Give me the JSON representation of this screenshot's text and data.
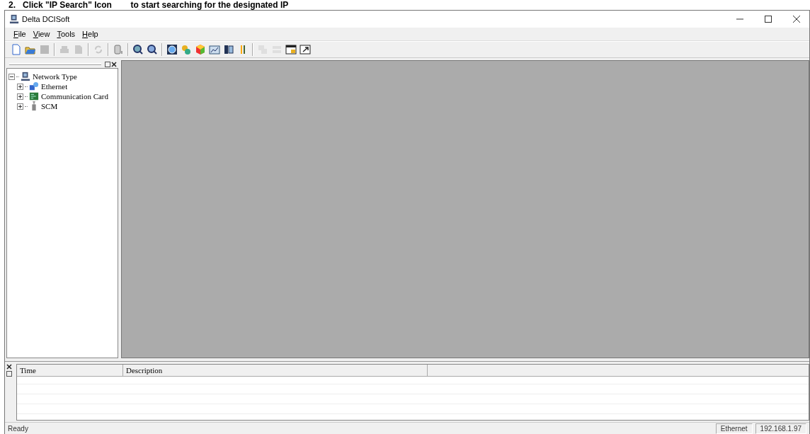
{
  "caption": "2.   Click \"IP Search\" Icon        to start searching for the designated IP",
  "window": {
    "title": "Delta DCISoft"
  },
  "menu": [
    "File",
    "View",
    "Tools",
    "Help"
  ],
  "toolbar": [
    {
      "kind": "button",
      "disabled": false
    },
    {
      "kind": "button",
      "disabled": false
    },
    {
      "kind": "button",
      "disabled": true
    },
    {
      "kind": "separator"
    },
    {
      "kind": "button",
      "disabled": true
    },
    {
      "kind": "button",
      "disabled": true
    },
    {
      "kind": "separator"
    },
    {
      "kind": "button",
      "disabled": true
    },
    {
      "kind": "separator"
    },
    {
      "kind": "button",
      "disabled": false
    },
    {
      "kind": "separator"
    },
    {
      "kind": "button",
      "disabled": false
    },
    {
      "kind": "button",
      "disabled": false
    },
    {
      "kind": "separator"
    },
    {
      "kind": "button",
      "disabled": false
    },
    {
      "kind": "button",
      "disabled": false
    },
    {
      "kind": "button",
      "disabled": false
    },
    {
      "kind": "button",
      "disabled": false
    },
    {
      "kind": "button",
      "disabled": false
    },
    {
      "kind": "button",
      "disabled": false
    },
    {
      "kind": "separator"
    },
    {
      "kind": "button",
      "disabled": true
    },
    {
      "kind": "button",
      "disabled": true
    },
    {
      "kind": "button",
      "disabled": false
    },
    {
      "kind": "button",
      "disabled": false
    }
  ],
  "tree": {
    "label": "Network Type",
    "expanded": true,
    "children": [
      {
        "label": "Ethernet",
        "expanded": false
      },
      {
        "label": "Communication Card",
        "expanded": false
      },
      {
        "label": "SCM",
        "expanded": false
      }
    ]
  },
  "log": {
    "columns": [
      "Time",
      "Description"
    ]
  },
  "status_bar": {
    "message": "Ready",
    "network": "Ethernet",
    "address": "192.168.1.97"
  }
}
